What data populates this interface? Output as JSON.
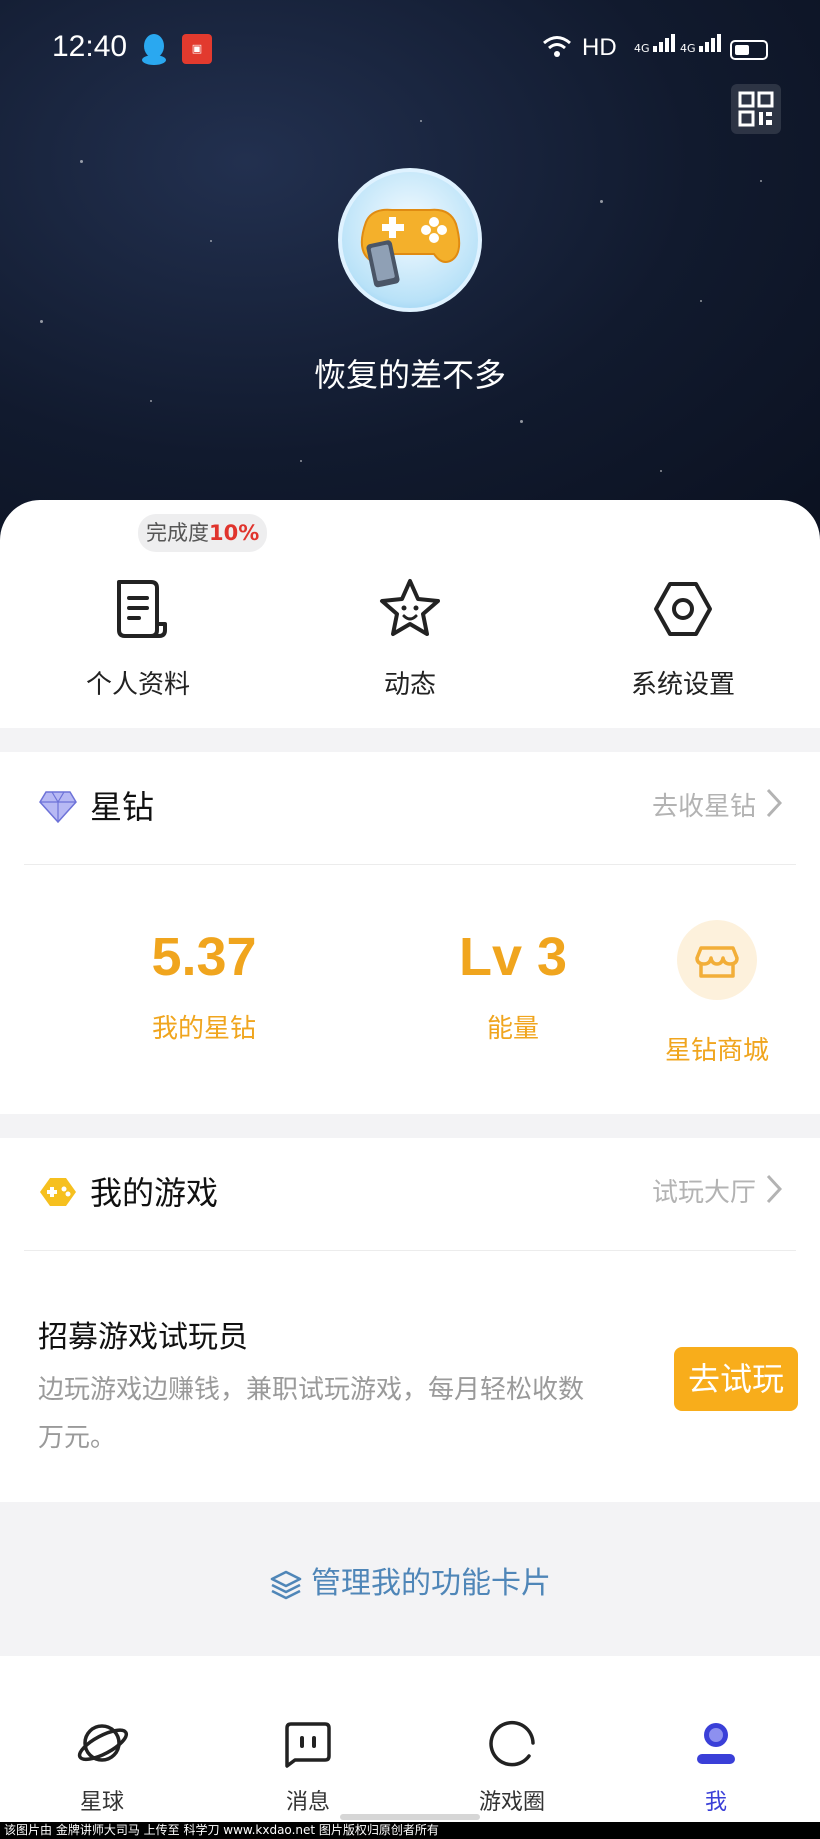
{
  "status_bar": {
    "time": "12:40",
    "hd": "HD",
    "signal1": "4G",
    "signal2": "4G"
  },
  "profile": {
    "nickname": "恢复的差不多",
    "completion_label": "完成度",
    "completion_value": "10%"
  },
  "quick_menu": [
    {
      "label": "个人资料",
      "icon": "document-icon"
    },
    {
      "label": "动态",
      "icon": "star-face-icon"
    },
    {
      "label": "系统设置",
      "icon": "settings-hex-icon"
    }
  ],
  "star_diamond": {
    "title": "星钻",
    "link": "去收星钻",
    "my_value": "5.37",
    "my_label": "我的星钻",
    "energy_value": "Lv 3",
    "energy_label": "能量",
    "mall_label": "星钻商城"
  },
  "my_games": {
    "title": "我的游戏",
    "link": "试玩大厅",
    "recruit_title": "招募游戏试玩员",
    "recruit_desc": "边玩游戏边赚钱，兼职试玩游戏，每月轻松收数万元。",
    "try_button": "去试玩"
  },
  "manage_cards": "管理我的功能卡片",
  "bottom_nav": [
    {
      "label": "星球",
      "icon": "planet-icon",
      "active": false
    },
    {
      "label": "消息",
      "icon": "message-icon",
      "active": false
    },
    {
      "label": "游戏圈",
      "icon": "circle-icon",
      "active": false
    },
    {
      "label": "我",
      "icon": "user-icon",
      "active": true
    }
  ],
  "watermark": "该图片由 金牌讲师大司马 上传至 科学刀 www.kxdao.net 图片版权归原创者所有",
  "colors": {
    "accent_orange": "#f0a51e",
    "active_blue": "#3a3fd8",
    "link_blue": "#4f86b8"
  }
}
